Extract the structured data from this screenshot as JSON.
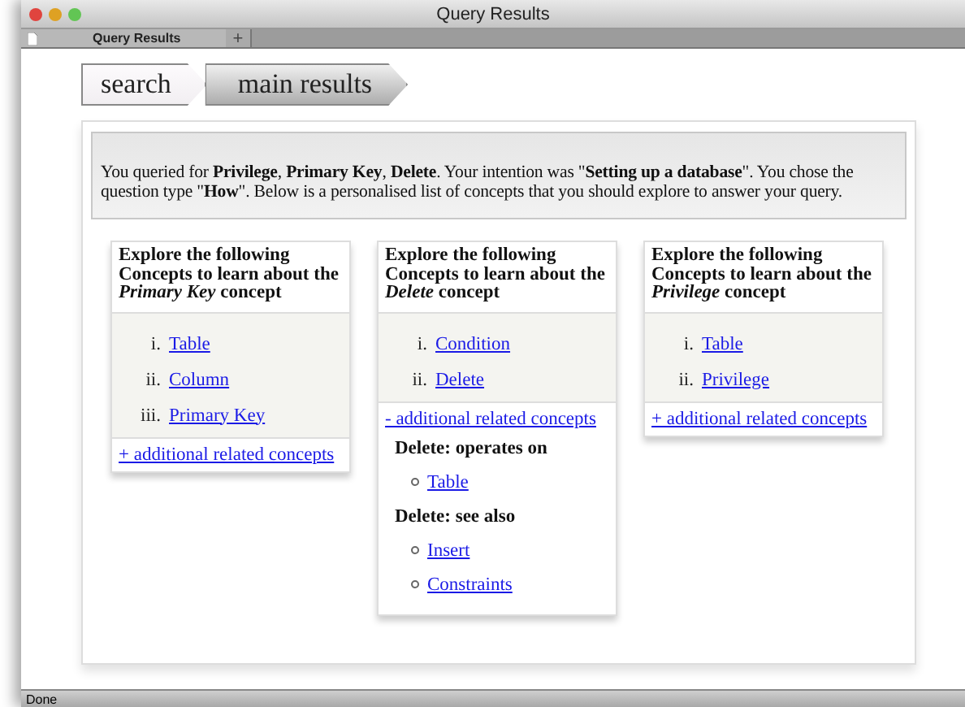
{
  "window": {
    "title": "Query Results"
  },
  "browser_tabs": [
    {
      "label": "Query Results"
    }
  ],
  "new_tab_button": "+",
  "breadcrumbs": [
    {
      "label": "search",
      "selected": false
    },
    {
      "label": "main results",
      "selected": true
    }
  ],
  "intro": "You queried for **Privilege**, **Primary Key**, **Delete**. Your intention was \"**Setting up a database**\". You chose the question type \"**How**\". Below is a personalised list of concepts that you should explore to answer your query.",
  "cards": [
    {
      "heading": "Explore the following Concepts to learn about the *Primary Key* concept",
      "concepts": [
        {
          "marker": "i.",
          "label": "Table"
        },
        {
          "marker": "ii.",
          "label": "Column"
        },
        {
          "marker": "iii.",
          "label": "Primary Key"
        }
      ],
      "toggle": "+ additional related concepts"
    },
    {
      "heading": "Explore the following Concepts to learn about the *Delete* concept",
      "concepts": [
        {
          "marker": "i.",
          "label": "Condition"
        },
        {
          "marker": "ii.",
          "label": "Delete"
        }
      ],
      "toggle": "- additional related concepts",
      "related": [
        {
          "title": "Delete: operates on",
          "items": [
            "Table"
          ]
        },
        {
          "title": "Delete: see also",
          "items": [
            "Insert",
            "Constraints"
          ]
        }
      ]
    },
    {
      "heading": "Explore the following Concepts to learn about the *Privilege* concept",
      "concepts": [
        {
          "marker": "i.",
          "label": "Table"
        },
        {
          "marker": "ii.",
          "label": "Privilege"
        }
      ],
      "toggle": "+ additional related concepts"
    }
  ],
  "status_bar": {
    "text": "Done"
  }
}
